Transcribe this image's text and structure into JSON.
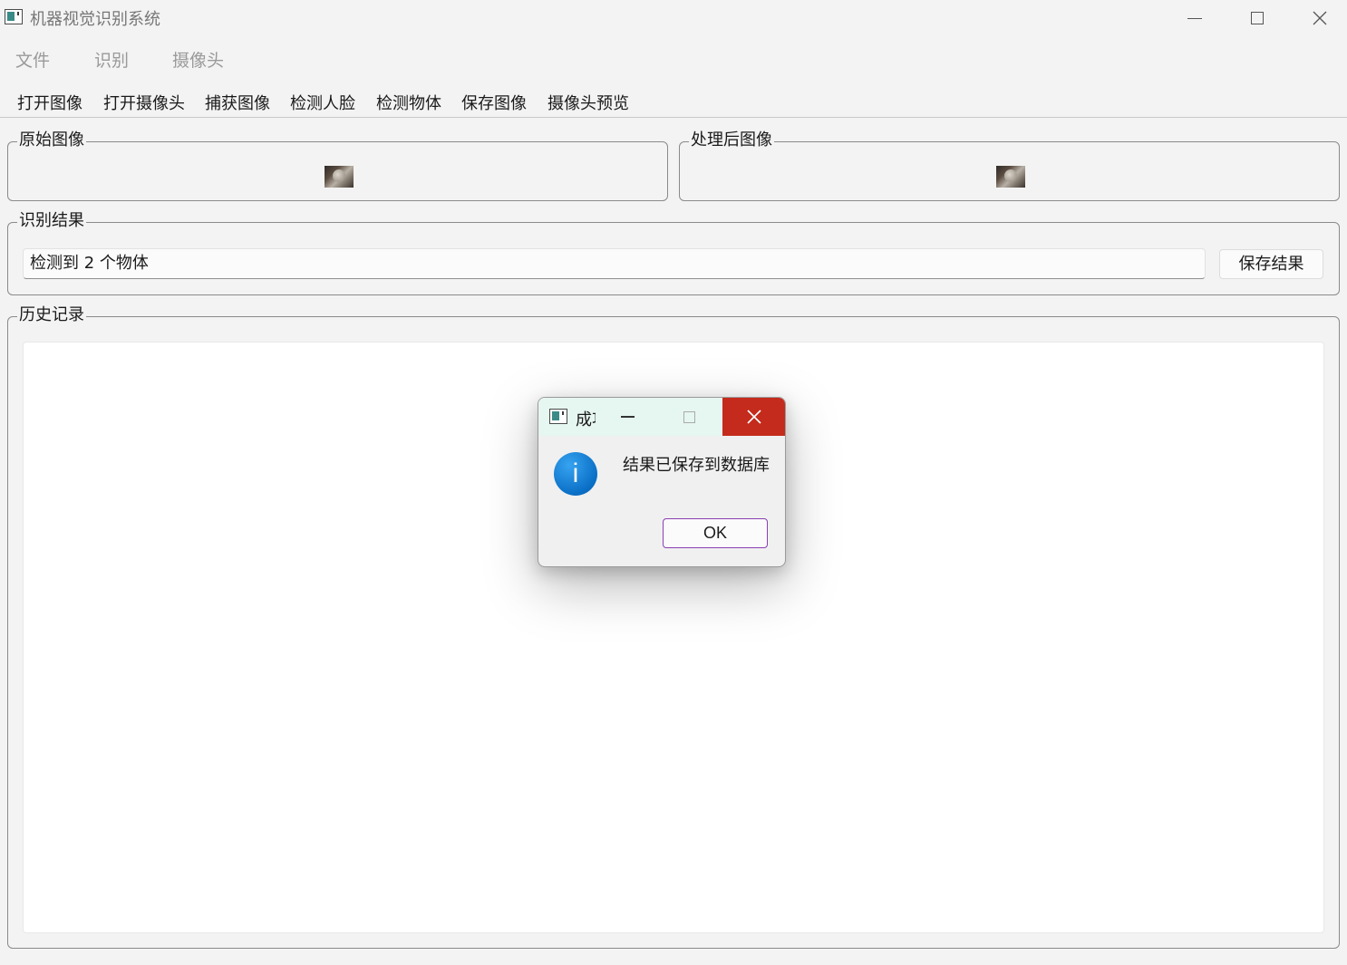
{
  "window": {
    "title": "机器视觉识别系统"
  },
  "menubar": {
    "items": [
      "文件",
      "识别",
      "摄像头"
    ]
  },
  "toolbar": {
    "buttons": [
      "打开图像",
      "打开摄像头",
      "捕获图像",
      "检测人脸",
      "检测物体",
      "保存图像",
      "摄像头预览"
    ]
  },
  "panels": {
    "original": {
      "title": "原始图像"
    },
    "processed": {
      "title": "处理后图像"
    },
    "result": {
      "title": "识别结果",
      "value": "检测到 2 个物体",
      "save_label": "保存结果"
    },
    "history": {
      "title": "历史记录"
    }
  },
  "dialog": {
    "title": "成功",
    "message": "结果已保存到数据库",
    "ok_label": "OK",
    "icon": "info-icon",
    "close_color": "#c42b1c"
  },
  "icons": {
    "app": "app-window-icon",
    "minimize": "minimize-icon",
    "maximize": "maximize-icon",
    "close": "close-icon"
  }
}
